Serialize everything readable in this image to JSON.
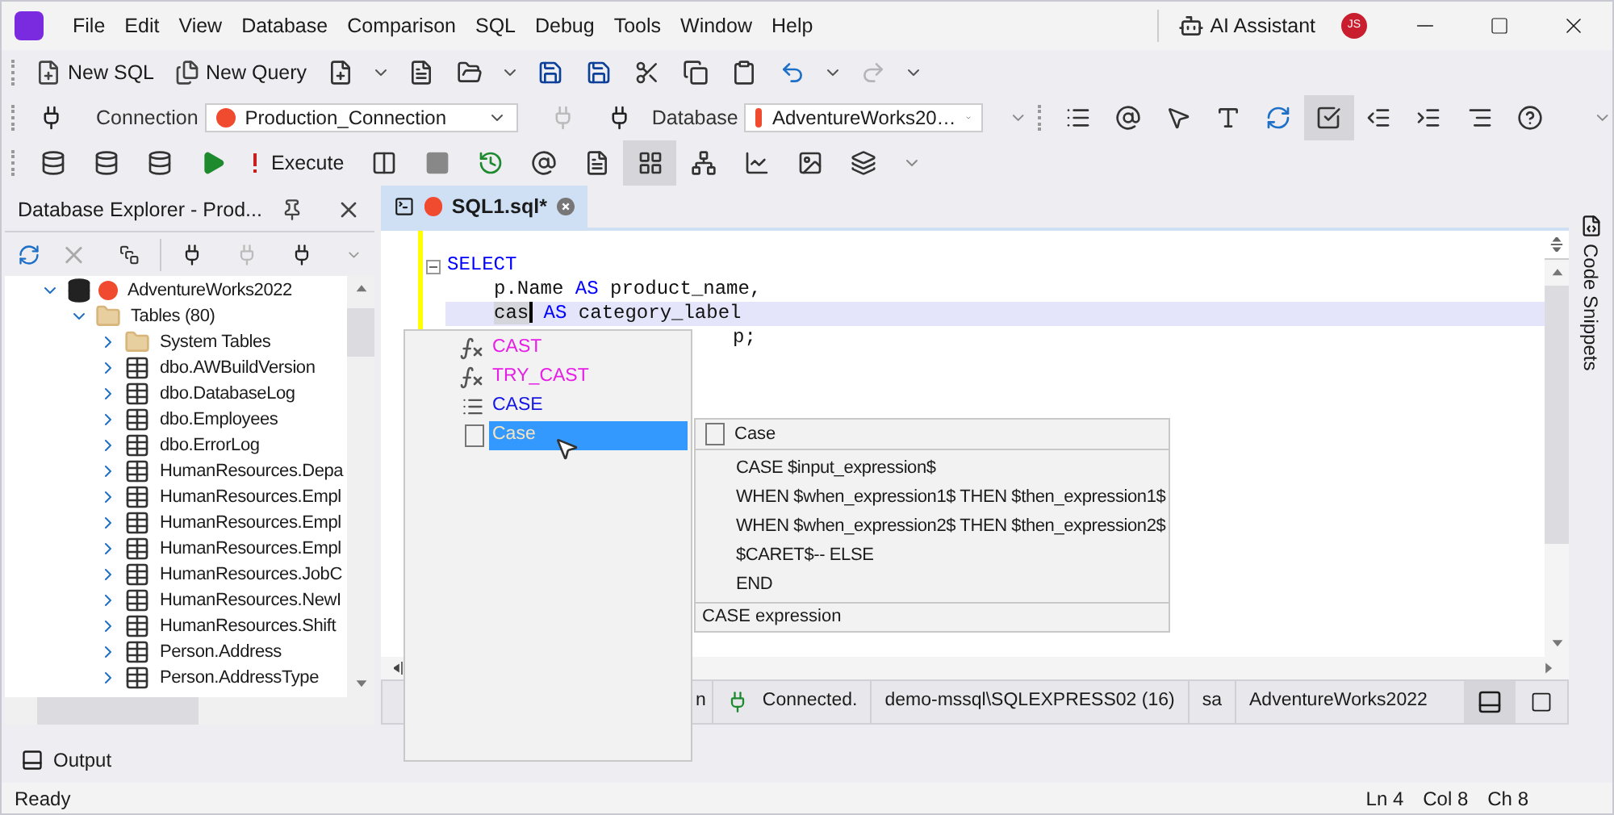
{
  "menu": [
    "File",
    "Edit",
    "View",
    "Database",
    "Comparison",
    "SQL",
    "Debug",
    "Tools",
    "Window",
    "Help"
  ],
  "title_bar": {
    "assistant": "AI Assistant",
    "avatar": "JS"
  },
  "toolbar1": [
    {
      "kind": "labeled",
      "label": "New SQL"
    },
    {
      "kind": "labeled",
      "label": "New Query"
    },
    {
      "kind": "icon"
    },
    {
      "kind": "caret"
    },
    {
      "kind": "icon"
    },
    {
      "kind": "icon"
    },
    {
      "kind": "caret"
    },
    {
      "kind": "icon"
    },
    {
      "kind": "icon"
    },
    {
      "kind": "icon"
    },
    {
      "kind": "icon"
    },
    {
      "kind": "icon"
    },
    {
      "kind": "icon"
    },
    {
      "kind": "caret"
    },
    {
      "kind": "icon",
      "disabled": true
    },
    {
      "kind": "caret"
    }
  ],
  "connection": {
    "label": "Connection",
    "value": "Production_Connection",
    "db_label": "Database",
    "db_value": "AdventureWorks20…"
  },
  "toolbar2_pressed": [
    false,
    false,
    false,
    false,
    false,
    true,
    false,
    false,
    false,
    false
  ],
  "toolbar3": [
    {
      "kind": "icon",
      "pressed": false
    },
    {
      "kind": "icon",
      "pressed": false
    },
    {
      "kind": "icon",
      "pressed": false
    },
    {
      "kind": "icon",
      "pressed": false
    },
    {
      "kind": "labeled",
      "label": "Execute",
      "pressed": false
    },
    {
      "kind": "icon",
      "pressed": false
    },
    {
      "kind": "icon",
      "pressed": false
    },
    {
      "kind": "icon",
      "pressed": false
    },
    {
      "kind": "icon",
      "pressed": false
    },
    {
      "kind": "icon",
      "pressed": false
    },
    {
      "kind": "icon",
      "pressed": true
    },
    {
      "kind": "icon",
      "pressed": false
    },
    {
      "kind": "icon",
      "pressed": false
    },
    {
      "kind": "icon",
      "pressed": false
    },
    {
      "kind": "icon",
      "pressed": false
    }
  ],
  "explorer": {
    "title": "Database Explorer - Prod...",
    "tree": [
      {
        "label": "AdventureWorks2022",
        "kind": "database",
        "expanded": true,
        "children": [
          {
            "label": "Tables (80)",
            "kind": "folder",
            "expanded": true,
            "children": [
              {
                "label": "System Tables",
                "kind": "folder",
                "expanded": false
              },
              {
                "label": "dbo.AWBuildVersion",
                "kind": "table",
                "expanded": false
              },
              {
                "label": "dbo.DatabaseLog",
                "kind": "table",
                "expanded": false
              },
              {
                "label": "dbo.Employees",
                "kind": "table",
                "expanded": false
              },
              {
                "label": "dbo.ErrorLog",
                "kind": "table",
                "expanded": false
              },
              {
                "label": "HumanResources.Depa",
                "kind": "table",
                "expanded": false
              },
              {
                "label": "HumanResources.Empl",
                "kind": "table",
                "expanded": false
              },
              {
                "label": "HumanResources.Empl",
                "kind": "table",
                "expanded": false
              },
              {
                "label": "HumanResources.Empl",
                "kind": "table",
                "expanded": false
              },
              {
                "label": "HumanResources.JobC",
                "kind": "table",
                "expanded": false
              },
              {
                "label": "HumanResources.NewI",
                "kind": "table",
                "expanded": false
              },
              {
                "label": "HumanResources.Shift",
                "kind": "table",
                "expanded": false
              },
              {
                "label": "Person.Address",
                "kind": "table",
                "expanded": false
              },
              {
                "label": "Person.AddressType",
                "kind": "table",
                "expanded": false
              }
            ]
          }
        ]
      }
    ]
  },
  "editor": {
    "tab": {
      "label": "SQL1.sql*",
      "selected": true
    },
    "lines": [
      {
        "current": false,
        "tokens": [
          {
            "kind": "keyword",
            "text": "SELECT"
          }
        ]
      },
      {
        "current": false,
        "indented": true,
        "tokens": [
          {
            "kind": "plain",
            "text": "p.Name "
          },
          {
            "kind": "keyword",
            "text": "AS"
          },
          {
            "kind": "plain",
            "text": " product_name,"
          }
        ]
      },
      {
        "current": true,
        "indented": true,
        "tokens": [
          {
            "kind": "typed",
            "text": "cas"
          },
          {
            "kind": "keyword",
            "text": " AS"
          },
          {
            "kind": "plain",
            "text": " category_label"
          }
        ]
      },
      {
        "current": false,
        "partly_hidden": true,
        "tokens": [
          {
            "kind": "plain",
            "text": "p;"
          }
        ]
      }
    ],
    "status": [
      "n",
      "Connected.",
      "demo-mssql\\SQLEXPRESS02 (16)",
      "sa",
      "AdventureWorks2022"
    ]
  },
  "side_panel": "Code Snippets",
  "completion": [
    {
      "kind": "function",
      "label": "CAST",
      "selected": false
    },
    {
      "kind": "function",
      "label": "TRY_CAST",
      "selected": false
    },
    {
      "kind": "keyword",
      "label": "CASE",
      "selected": false
    },
    {
      "kind": "snippet",
      "label": "Case",
      "selected": true
    }
  ],
  "snippet_preview": {
    "title": "Case",
    "lines": [
      "CASE $input_expression$",
      "WHEN $when_expression1$ THEN $then_expression1$",
      "WHEN $when_expression2$ THEN $then_expression2$",
      "$CARET$-- ELSE",
      "END"
    ],
    "description": "CASE expression"
  },
  "output": "Output",
  "status_bar": {
    "message": "Ready",
    "ln": "Ln 4",
    "col": "Col 8",
    "ch": "Ch 8"
  }
}
